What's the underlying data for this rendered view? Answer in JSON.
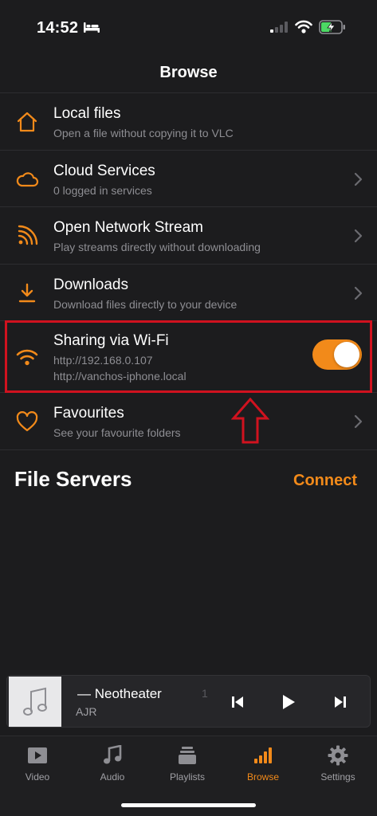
{
  "status_bar": {
    "time": "14:52"
  },
  "nav": {
    "title": "Browse"
  },
  "browse_items": [
    {
      "title": "Local files",
      "subtitle": "Open a file without copying it to VLC",
      "icon": "home-icon"
    },
    {
      "title": "Cloud Services",
      "subtitle": "0 logged in services",
      "icon": "cloud-icon"
    },
    {
      "title": "Open Network Stream",
      "subtitle": "Play streams directly without downloading",
      "icon": "rss-icon"
    },
    {
      "title": "Downloads",
      "subtitle": "Download files directly to your device",
      "icon": "download-icon"
    },
    {
      "title": "Sharing via Wi-Fi",
      "subtitle": "http://192.168.0.107",
      "subtitle2": "http://vanchos-iphone.local",
      "icon": "wifi-icon",
      "toggle_on": true
    },
    {
      "title": "Favourites",
      "subtitle": "See your favourite folders",
      "icon": "heart-icon"
    }
  ],
  "file_servers": {
    "title": "File Servers",
    "connect_label": "Connect"
  },
  "mini_player": {
    "title": "— Neotheater",
    "artist": "AJR",
    "extra": "1"
  },
  "tabs": [
    {
      "label": "Video",
      "icon": "video-icon",
      "active": false
    },
    {
      "label": "Audio",
      "icon": "music-note-icon",
      "active": false
    },
    {
      "label": "Playlists",
      "icon": "playlist-icon",
      "active": false
    },
    {
      "label": "Browse",
      "icon": "browse-bars-icon",
      "active": true
    },
    {
      "label": "Settings",
      "icon": "gear-icon",
      "active": false
    }
  ],
  "colors": {
    "accent": "#f28a1a",
    "background": "#1c1c1e",
    "highlight": "#d0121f"
  }
}
